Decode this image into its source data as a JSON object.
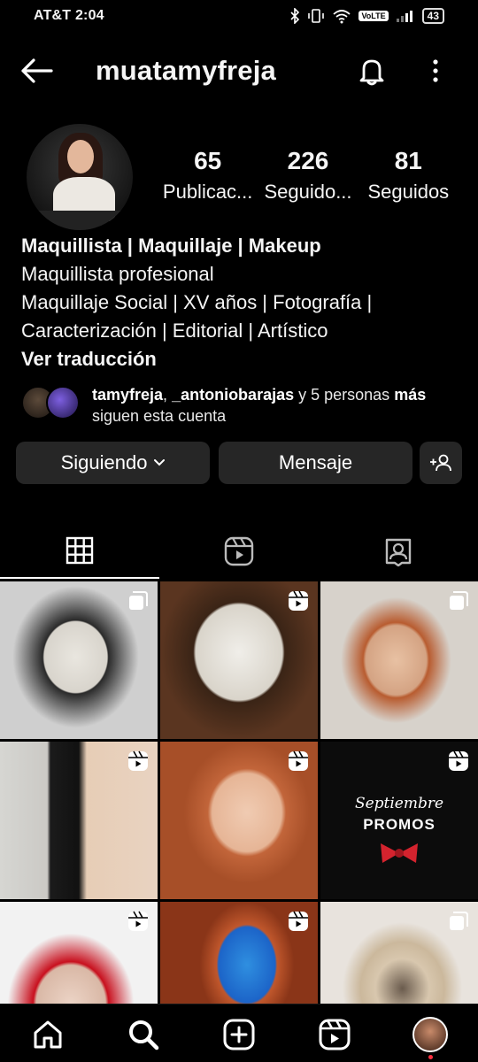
{
  "status_bar": {
    "carrier": "AT&T",
    "time": "2:04",
    "network_badge": "VoLTE",
    "battery": "43"
  },
  "header": {
    "username": "muatamyfreja"
  },
  "profile": {
    "stats": [
      {
        "value": "65",
        "label": "Publicac..."
      },
      {
        "value": "226",
        "label": "Seguido..."
      },
      {
        "value": "81",
        "label": "Seguidos"
      }
    ],
    "bio": {
      "name": "Maquillista | Maquillaje | Makeup",
      "line1": "Maquillista profesional",
      "line2": "Maquillaje Social | XV años | Fotografía |",
      "line3": "Caracterización | Editorial | Artístico",
      "translate": "Ver traducción"
    },
    "followed_by": {
      "user1": "tamyfreja",
      "sep": ", ",
      "user2": "_antoniobarajas",
      "mid": " y 5 personas",
      "more": "más",
      "tail": " siguen esta cuenta"
    }
  },
  "actions": {
    "following": "Siguiendo",
    "message": "Mensaje"
  },
  "grid": {
    "promo_title": "Septiembre",
    "promo_sub": "PROMOS"
  },
  "colors": {
    "background": "#000000",
    "button_bg": "#262626",
    "notification_dot": "#ff3040"
  }
}
